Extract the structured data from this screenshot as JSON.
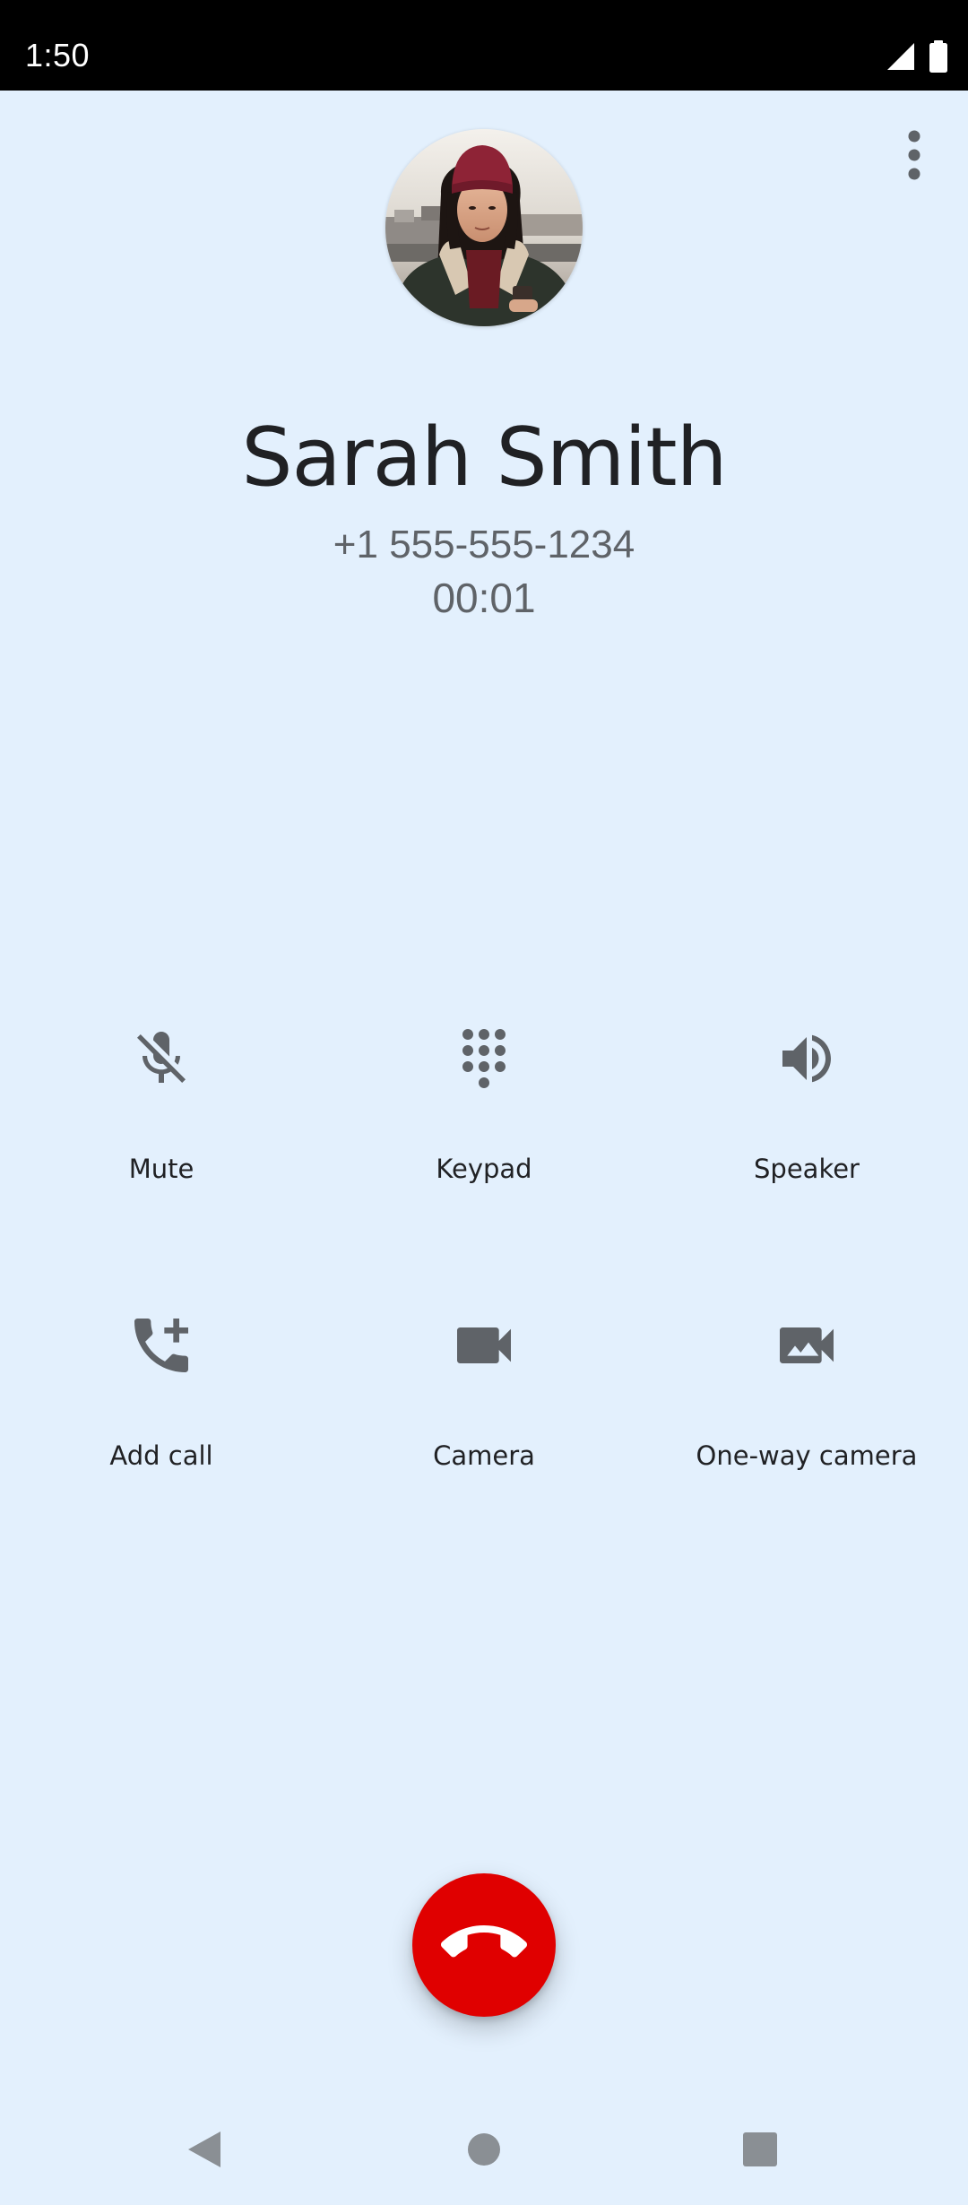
{
  "status_bar": {
    "time": "1:50",
    "icons": [
      "cell-signal-icon",
      "battery-icon"
    ]
  },
  "menu": {
    "icon": "more-vertical-icon"
  },
  "caller": {
    "name": "Sarah Smith",
    "number": "+1 555-555-1234",
    "duration": "00:01",
    "avatar_icon": "contact-photo"
  },
  "actions": [
    {
      "label": "Mute",
      "icon": "mic-off-icon"
    },
    {
      "label": "Keypad",
      "icon": "dialpad-icon"
    },
    {
      "label": "Speaker",
      "icon": "volume-up-icon"
    },
    {
      "label": "Add call",
      "icon": "add-call-icon"
    },
    {
      "label": "Camera",
      "icon": "videocam-icon"
    },
    {
      "label": "One-way camera",
      "icon": "photo-camera-icon"
    }
  ],
  "end_call": {
    "icon": "call-end-icon"
  },
  "navigation": {
    "buttons": [
      "back-icon",
      "home-icon",
      "recents-icon"
    ]
  },
  "colors": {
    "background": "#e3f0fd",
    "status_bar": "#000000",
    "end_call": "#e00000",
    "icon": "#5f6368",
    "text_primary": "#202124"
  }
}
